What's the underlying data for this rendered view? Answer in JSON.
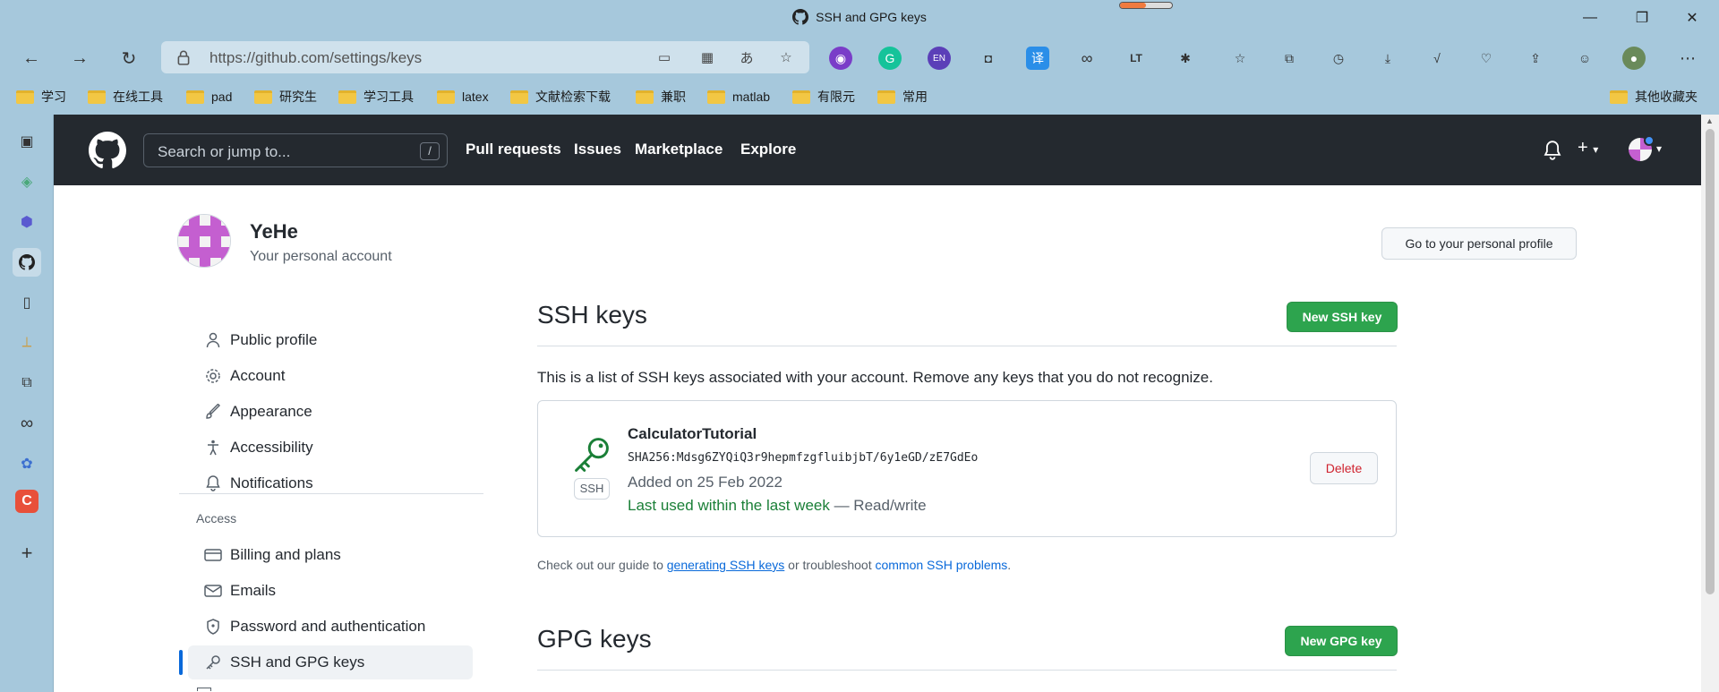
{
  "browser": {
    "tab_title": "SSH and GPG keys",
    "loading_progress": 0.5,
    "url": "https://github.com/settings/keys",
    "bookmarks": [
      "学习",
      "在线工具",
      "pad",
      "研究生",
      "学习工具",
      "latex",
      "文献检索下载",
      "兼职",
      "matlab",
      "有限元",
      "常用"
    ],
    "other_bookmarks": "其他收藏夹"
  },
  "github": {
    "search_placeholder": "Search or jump to...",
    "search_shortcut": "/",
    "nav": [
      "Pull requests",
      "Issues",
      "Marketplace",
      "Explore"
    ]
  },
  "account": {
    "name": "YeHe",
    "subtitle": "Your personal account",
    "profile_button": "Go to your personal profile"
  },
  "menu": {
    "items": [
      "Public profile",
      "Account",
      "Appearance",
      "Accessibility",
      "Notifications"
    ],
    "access_heading": "Access",
    "access_items": [
      "Billing and plans",
      "Emails",
      "Password and authentication",
      "SSH and GPG keys"
    ]
  },
  "ssh": {
    "title": "SSH keys",
    "new_button": "New SSH key",
    "description": "This is a list of SSH keys associated with your account. Remove any keys that you do not recognize.",
    "key": {
      "label": "SSH",
      "title": "CalculatorTutorial",
      "fingerprint": "SHA256:Mdsg6ZYQiQ3r9hepmfzgfluibjbT/6y1eGD/zE7GdEo",
      "added": "Added on 25 Feb 2022",
      "last_used": "Last used within the last week",
      "access": " — Read/write",
      "delete_button": "Delete"
    },
    "guide_prefix": "Check out our guide to ",
    "guide_link1": "generating SSH keys",
    "guide_middle": " or troubleshoot ",
    "guide_link2": "common SSH problems",
    "guide_suffix": "."
  },
  "gpg": {
    "title": "GPG keys",
    "new_button": "New GPG key"
  },
  "colors": {
    "header_bg": "#24292f",
    "primary_green": "#2da44e",
    "danger": "#cf222e",
    "link": "#0969da",
    "browser_frame": "#a6c8dc"
  }
}
